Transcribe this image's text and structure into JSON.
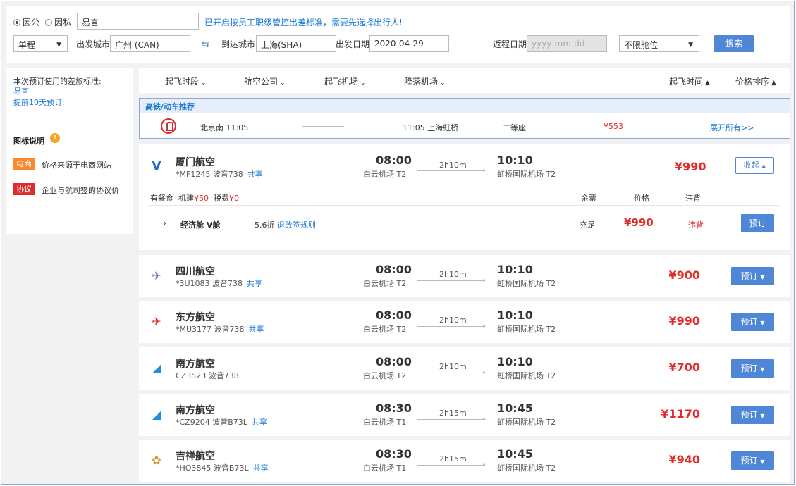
{
  "search": {
    "trip_public": "因公",
    "trip_private": "因私",
    "traveler_value": "易言",
    "notice": "已开启按员工职级管控出差标准，需要先选择出行人!",
    "trip_type": "单程",
    "depart_city_label": "出发城市",
    "depart_city_value": "广州 (CAN)",
    "arrive_city_label": "到达城市",
    "arrive_city_value": "上海(SHA)",
    "depart_date_label": "出发日期",
    "depart_date_value": "2020-04-29",
    "return_date_label": "返程日期",
    "return_date_placeholder": "yyyy-mm-dd",
    "cabin_value": "不限舱位",
    "search_button": "搜索"
  },
  "sidebar": {
    "standard_title": "本次预订使用的差旅标准:",
    "standard_person": "易言",
    "standard_rule": "提前10天预订;",
    "legend_title": "图标说明",
    "legend_items": [
      {
        "tag": "电商",
        "desc": "价格来源于电商网站",
        "color": "#f5892c"
      },
      {
        "tag": "协议",
        "desc": "企业与航司签的协议价",
        "color": "#e02b2b"
      }
    ]
  },
  "filters": {
    "depart_period": "起飞时段",
    "airline": "航空公司",
    "depart_airport": "起飞机场",
    "arrive_airport": "降落机场",
    "depart_time_sort": "起飞时间",
    "price_sort": "价格排序"
  },
  "rail": {
    "header": "高铁/动车推荐",
    "from": "北京南 11:05",
    "to": "11:05 上海虹桥",
    "seat": "二等座",
    "price": "¥553",
    "expand": "展开所有>>"
  },
  "expanded_detail": {
    "meal": "有餐食",
    "fee_label1": "机建",
    "fee1": "¥50",
    "fee_label2": "税费",
    "fee2": "¥0",
    "col_remaining": "余票",
    "col_price": "价格",
    "col_violation": "违背",
    "cabin": "经济舱 V舱",
    "discount": "5.6折",
    "rules_link": "退改签规则",
    "remaining": "充足",
    "price": "¥990",
    "violation": "违背",
    "book": "预订",
    "collapse": "收起"
  },
  "flights": [
    {
      "airline": "厦门航空",
      "flight": "*MF1245",
      "aircraft": "波音738",
      "shared": "共享",
      "dep_time": "08:00",
      "dep_airport": "白云机场 T2",
      "duration": "2h10m",
      "arr_time": "10:10",
      "arr_airport": "虹桥国际机场 T2",
      "price": "¥990",
      "logo": "V",
      "logo_color": "#1f6fc2"
    },
    {
      "airline": "四川航空",
      "flight": "*3U1083",
      "aircraft": "波音738",
      "shared": "共享",
      "dep_time": "08:00",
      "dep_airport": "白云机场 T2",
      "duration": "2h10m",
      "arr_time": "10:10",
      "arr_airport": "虹桥国际机场 T2",
      "price": "¥900",
      "book": "预订",
      "logo": "✈",
      "logo_color": "#6b7fa8"
    },
    {
      "airline": "东方航空",
      "flight": "*MU3177",
      "aircraft": "波音738",
      "shared": "共享",
      "dep_time": "08:00",
      "dep_airport": "白云机场 T2",
      "duration": "2h10m",
      "arr_time": "10:10",
      "arr_airport": "虹桥国际机场 T2",
      "price": "¥990",
      "book": "预订",
      "logo": "✈",
      "logo_color": "#d62b2b"
    },
    {
      "airline": "南方航空",
      "flight": "CZ3523",
      "aircraft": "波音738",
      "shared": "",
      "dep_time": "08:00",
      "dep_airport": "白云机场 T2",
      "duration": "2h10m",
      "arr_time": "10:10",
      "arr_airport": "虹桥国际机场 T2",
      "price": "¥700",
      "book": "预订",
      "logo": "◢",
      "logo_color": "#1f8fd6"
    },
    {
      "airline": "南方航空",
      "flight": "*CZ9204",
      "aircraft": "波音B73L",
      "shared": "共享",
      "dep_time": "08:30",
      "dep_airport": "白云机场 T1",
      "duration": "2h15m",
      "arr_time": "10:45",
      "arr_airport": "虹桥国际机场 T2",
      "price": "¥1170",
      "book": "预订",
      "logo": "◢",
      "logo_color": "#1f8fd6"
    },
    {
      "airline": "吉祥航空",
      "flight": "*HO3845",
      "aircraft": "波音B73L",
      "shared": "共享",
      "dep_time": "08:30",
      "dep_airport": "白云机场 T1",
      "duration": "2h15m",
      "arr_time": "10:45",
      "arr_airport": "虹桥国际机场 T2",
      "price": "¥940",
      "book": "预订",
      "logo": "✿",
      "logo_color": "#c9962c"
    }
  ]
}
